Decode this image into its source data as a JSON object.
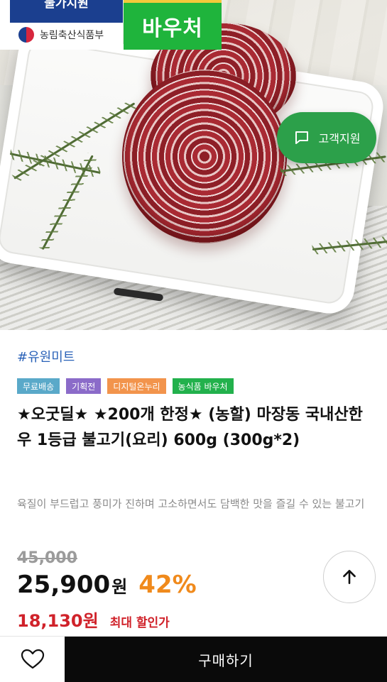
{
  "hero": {
    "gov_badge": {
      "top_text": "물가지원",
      "agency": "농림축산식품부"
    },
    "voucher_badge": "바우처",
    "support_button": {
      "label": "고객지원",
      "icon": "chat-bubble-icon"
    }
  },
  "product": {
    "brand": "#유원미트",
    "tags": [
      {
        "label": "무료배송",
        "color": "#5aa9c9"
      },
      {
        "label": "기획전",
        "color": "#8b6bc9"
      },
      {
        "label": "디지털온누리",
        "color": "#f2944c"
      },
      {
        "label": "농식품 바우처",
        "color": "#22b14c"
      }
    ],
    "title": "★오굿딜★ ★200개 한정★ (농할) 마장동 국내산한우 1등급 불고기(요리) 600g (300g*2)",
    "description": "육질이 부드럽고 풍미가 진하며 고소하면서도 담백한 맛을 즐길 수 있는 불고기",
    "original_price": "45,000",
    "price": "25,900",
    "price_unit": "원",
    "discount": "42%",
    "max_discount_price": "18,130원",
    "max_discount_label": "최대 할인가"
  },
  "controls": {
    "scroll_top_icon": "arrow-up-icon",
    "wishlist_icon": "heart-icon",
    "buy_label": "구매하기"
  }
}
